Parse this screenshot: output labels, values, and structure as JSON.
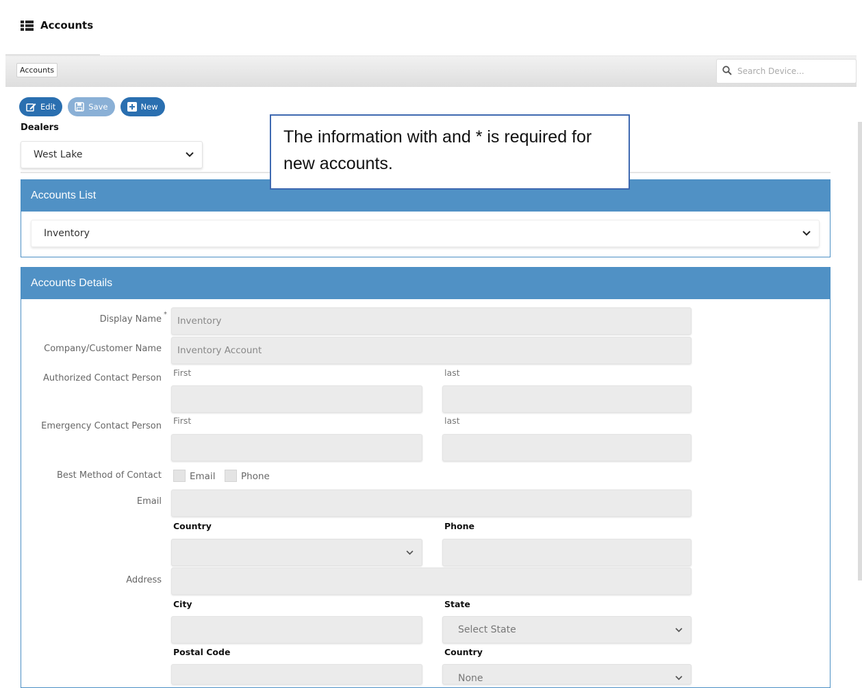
{
  "header": {
    "title": "Accounts",
    "icon": "list-icon"
  },
  "breadcrumb": {
    "label": "Accounts"
  },
  "search": {
    "placeholder": "Search Device..."
  },
  "toolbar": {
    "edit_label": "Edit",
    "save_label": "Save",
    "new_label": "New"
  },
  "dealers": {
    "label": "Dealers",
    "selected": "West Lake"
  },
  "callout": {
    "text": "The information with and * is required for new accounts."
  },
  "accounts_list": {
    "title": "Accounts List",
    "selected": "Inventory"
  },
  "details": {
    "title": "Accounts Details",
    "display_name": {
      "label": "Display Name",
      "required_mark": "*",
      "value": "Inventory"
    },
    "company_name": {
      "label": "Company/Customer Name",
      "value": "Inventory Account"
    },
    "authorized_contact": {
      "label": "Authorized Contact Person",
      "first_label": "First",
      "last_label": "last",
      "first_value": "",
      "last_value": ""
    },
    "emergency_contact": {
      "label": "Emergency Contact Person",
      "first_label": "First",
      "last_label": "last",
      "first_value": "",
      "last_value": ""
    },
    "best_method": {
      "label": "Best Method of Contact",
      "options": [
        "Email",
        "Phone"
      ]
    },
    "email": {
      "label": "Email",
      "value": ""
    },
    "country_label": "Country",
    "phone_label": "Phone",
    "country_value": "",
    "phone_value": "",
    "address": {
      "label": "Address",
      "value": ""
    },
    "city_label": "City",
    "state_label": "State",
    "state_value": "Select State",
    "postal_label": "Postal Code",
    "country2_label": "Country",
    "country2_value": "None"
  },
  "colors": {
    "panel_header": "#5091c5",
    "button": "#2a6fb0",
    "callout_border": "#3d68b0"
  }
}
